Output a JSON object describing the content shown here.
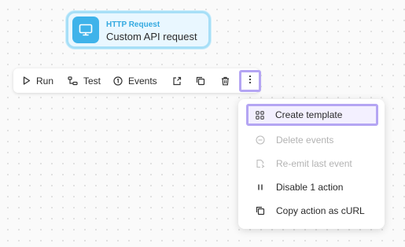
{
  "node": {
    "type_label": "HTTP Request",
    "title": "Custom API request",
    "icon": "monitor-icon",
    "accent_color": "#3fb3ea"
  },
  "toolbar": {
    "run_label": "Run",
    "test_label": "Test",
    "events_label": "Events",
    "icons": [
      "play-icon",
      "test-icon",
      "events-icon",
      "export-icon",
      "duplicate-icon",
      "trash-icon",
      "more-vertical-icon"
    ]
  },
  "menu": {
    "items": [
      {
        "label": "Create template",
        "icon": "template-icon",
        "disabled": false,
        "highlighted": true
      },
      {
        "label": "Delete events",
        "icon": "minus-circle-icon",
        "disabled": true
      },
      {
        "label": "Re-emit last event",
        "icon": "re-emit-icon",
        "disabled": true
      },
      {
        "label": "Disable 1 action",
        "icon": "pause-icon",
        "disabled": false
      },
      {
        "label": "Copy action as cURL",
        "icon": "copy-icon",
        "disabled": false
      }
    ]
  },
  "colors": {
    "highlight_border": "#b4a5f3",
    "node_border": "#a7dff7",
    "disabled_text": "#b3b3b3"
  }
}
